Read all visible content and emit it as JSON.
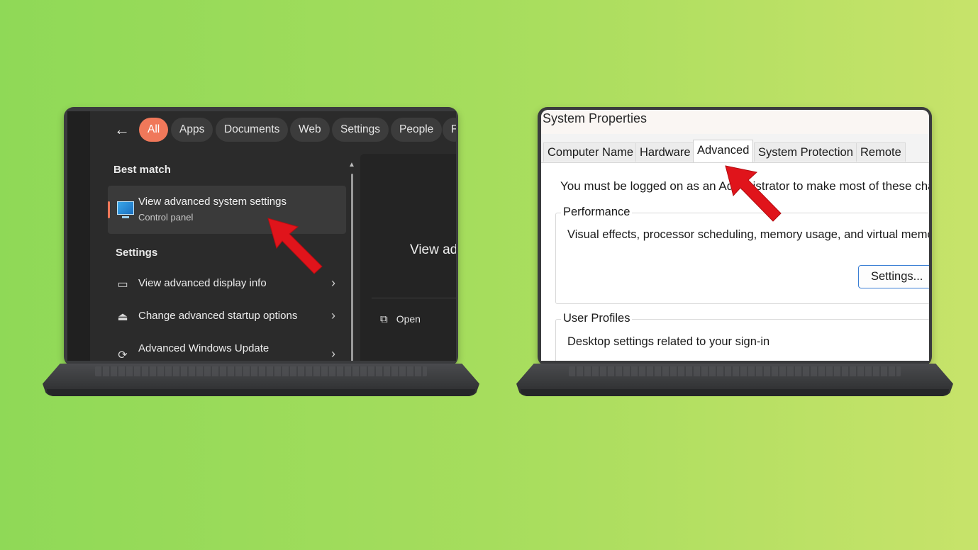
{
  "left_panel": {
    "filters": [
      "All",
      "Apps",
      "Documents",
      "Web",
      "Settings",
      "People",
      "F"
    ],
    "best_match_heading": "Best match",
    "best_match": {
      "title": "View advanced system settings",
      "subtitle": "Control panel"
    },
    "settings_heading": "Settings",
    "settings_items": [
      {
        "label": "View advanced display info",
        "icon": "laptop-icon"
      },
      {
        "label": "Change advanced startup options",
        "icon": "startup-icon"
      },
      {
        "label": "Advanced Windows Update",
        "icon": "sync-icon"
      }
    ],
    "preview_title": "View ad",
    "open_label": "Open"
  },
  "right_panel": {
    "window_title": "System Properties",
    "tabs": [
      "Computer Name",
      "Hardware",
      "Advanced",
      "System Protection",
      "Remote"
    ],
    "active_tab": "Advanced",
    "admin_note": "You must be logged on as an Administrator to make most of these chang",
    "performance": {
      "title": "Performance",
      "description": "Visual effects, processor scheduling, memory usage, and virtual memory",
      "button": "Settings..."
    },
    "user_profiles": {
      "title": "User Profiles",
      "description": "Desktop settings related to your sign-in"
    }
  },
  "colors": {
    "accent_chip": "#f0785a",
    "annotation_arrow": "#e0141b",
    "button_border": "#3b7fd4"
  }
}
